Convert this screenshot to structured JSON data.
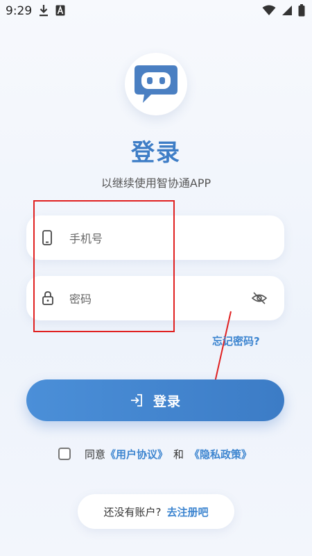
{
  "status_bar": {
    "time": "9:29",
    "icons_left": [
      "download-icon",
      "font-a-icon"
    ],
    "icons_right": [
      "wifi-icon",
      "signal-icon",
      "battery-icon"
    ]
  },
  "logo": {
    "icon": "chat-bot-icon"
  },
  "title": "登录",
  "subtitle": "以继续使用智协通APP",
  "phone_field": {
    "placeholder": "手机号",
    "value": "",
    "icon": "phone-icon"
  },
  "password_field": {
    "placeholder": "密码",
    "value": "",
    "icon": "lock-icon",
    "toggle_icon": "eye-off-icon"
  },
  "forgot_password": "忘记密码?",
  "login_button": {
    "label": "登录",
    "icon": "login-icon"
  },
  "agreement": {
    "checked": false,
    "prefix": "同意",
    "user_agreement": "《用户协议》",
    "and": "和",
    "privacy_policy": "《隐私政策》"
  },
  "register": {
    "prompt": "还没有账户?",
    "link": "去注册吧"
  },
  "colors": {
    "accent": "#3e7dc6",
    "link": "#3d85d0",
    "annotation": "#e02020"
  }
}
